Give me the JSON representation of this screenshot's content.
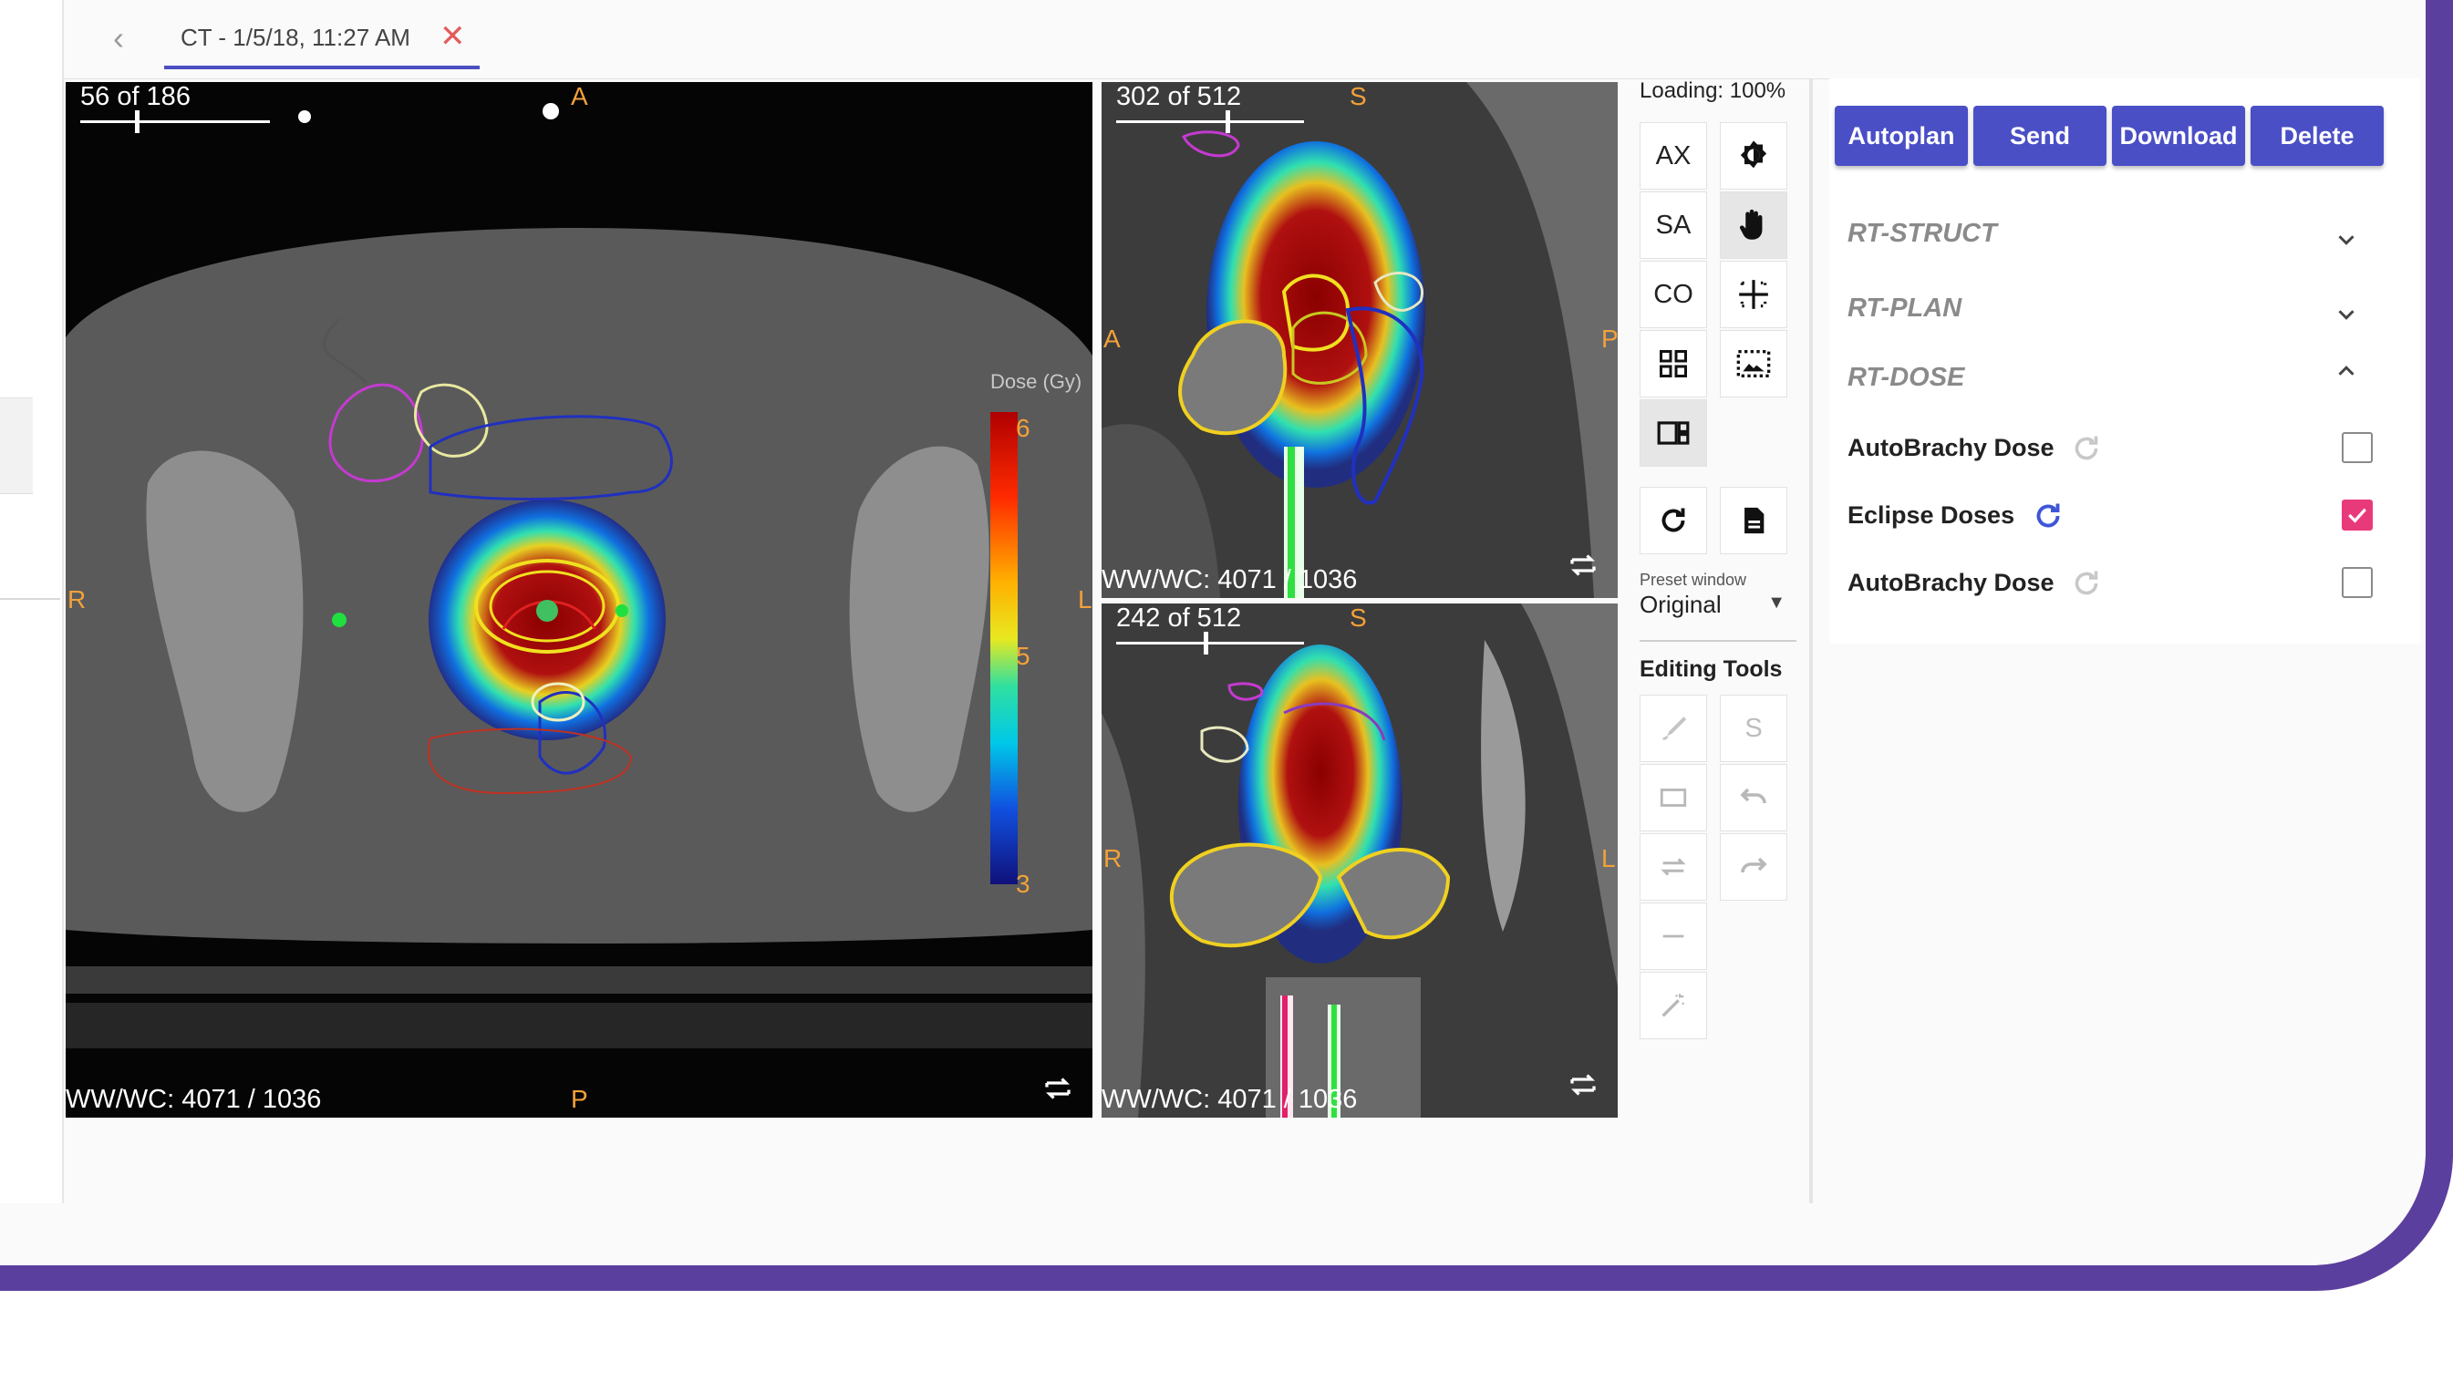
{
  "header": {
    "back_glyph": "‹",
    "tab_label": "CT - 1/5/18, 11:27 AM",
    "close_glyph": "✕"
  },
  "viewports": {
    "axial": {
      "slice": "56 of 186",
      "slice_progress": 0.3,
      "window": "WW/WC: 4071 / 1036",
      "orient": {
        "top": "A",
        "bottom": "P",
        "left": "R",
        "right": "L"
      },
      "colorbar": {
        "title": "Dose (Gy)",
        "max": "6",
        "mid": "5",
        "min": "3"
      }
    },
    "sagittal": {
      "slice": "302 of 512",
      "slice_progress": 0.59,
      "window": "WW/WC: 4071 / 1036",
      "orient": {
        "top": "S",
        "left": "A",
        "right": "P"
      }
    },
    "coronal": {
      "slice": "242 of 512",
      "slice_progress": 0.47,
      "window": "WW/WC: 4071 / 1036",
      "orient": {
        "top": "S",
        "left": "R",
        "right": "L"
      }
    }
  },
  "tools": {
    "loading": "Loading: 100%",
    "view_buttons": [
      "AX",
      "SA",
      "CO"
    ],
    "icons": [
      "contrast-icon",
      "pan-hand-icon",
      "crosshair-icon",
      "grid-layout-icon",
      "image-select-icon",
      "side-layout-icon",
      "refresh-icon",
      "document-icon"
    ],
    "preset_label": "Preset window",
    "preset_value": "Original",
    "editing_title": "Editing Tools",
    "editing_s": "S"
  },
  "actions": {
    "autoplan": "Autoplan",
    "send": "Send",
    "download": "Download",
    "delete": "Delete"
  },
  "sections": {
    "rt_struct": "RT-STRUCT",
    "rt_plan": "RT-PLAN",
    "rt_dose": "RT-DOSE"
  },
  "doses": [
    {
      "label": "AutoBrachy Dose",
      "checked": false
    },
    {
      "label": "Eclipse Doses",
      "checked": true
    },
    {
      "label": "AutoBrachy Dose",
      "checked": false
    }
  ],
  "colors": {
    "accent": "#4a4fc6",
    "checkbox_checked": "#e83a7a",
    "orientation": "#f3a13a",
    "frame": "#5b3f9e"
  }
}
